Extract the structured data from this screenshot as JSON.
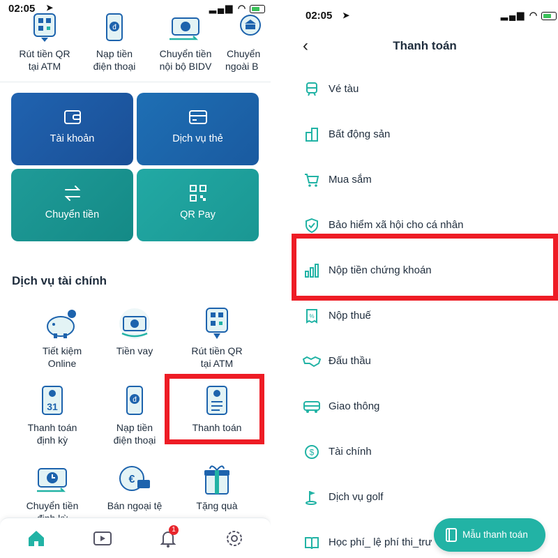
{
  "left": {
    "status": {
      "time": "02:05"
    },
    "quick_actions": [
      {
        "label_1": "Rút tiền QR",
        "label_2": "tại ATM",
        "icon": "qr-atm-icon"
      },
      {
        "label_1": "Nạp tiền",
        "label_2": "điện thoại",
        "icon": "phone-topup-icon"
      },
      {
        "label_1": "Chuyển tiền",
        "label_2": "nội bộ BIDV",
        "icon": "transfer-internal-icon"
      },
      {
        "label_1": "Chuyển",
        "label_2": "ngoài B",
        "icon": "bank-transfer-icon"
      }
    ],
    "tiles": [
      {
        "label": "Tài khoản",
        "icon": "wallet-icon"
      },
      {
        "label": "Dịch vụ thẻ",
        "icon": "card-icon"
      },
      {
        "label": "Chuyển tiền",
        "icon": "transfer-arrows-icon"
      },
      {
        "label": "QR Pay",
        "icon": "qr-icon"
      }
    ],
    "section_title": "Dịch vụ tài chính",
    "services": [
      {
        "label_1": "Tiết kiệm",
        "label_2": "Online"
      },
      {
        "label_1": "Tiền vay",
        "label_2": ""
      },
      {
        "label_1": "Rút tiền QR",
        "label_2": "tại ATM"
      },
      {
        "label_1": "Thanh toán",
        "label_2": "định kỳ",
        "badge": "31"
      },
      {
        "label_1": "Nạp tiền",
        "label_2": "điện thoại"
      },
      {
        "label_1": "Thanh toán",
        "label_2": ""
      },
      {
        "label_1": "Chuyển tiền",
        "label_2": "định kỳ"
      },
      {
        "label_1": "Bán ngoại tệ",
        "label_2": ""
      },
      {
        "label_1": "Tặng quà",
        "label_2": ""
      }
    ],
    "bottom_nav": {
      "notification_count": "1"
    }
  },
  "right": {
    "status": {
      "time": "02:05"
    },
    "header": {
      "back": "‹",
      "title": "Thanh toán"
    },
    "menu": [
      {
        "label": "Vé tàu",
        "icon": "train-icon"
      },
      {
        "label": "Bất động sản",
        "icon": "building-icon"
      },
      {
        "label": "Mua sắm",
        "icon": "cart-icon"
      },
      {
        "label": "Bảo hiểm xã hội cho cá nhân",
        "icon": "shield-icon"
      },
      {
        "label": "Nộp tiền chứng khoán",
        "icon": "bar-chart-icon"
      },
      {
        "label": "Nộp thuế",
        "icon": "receipt-icon"
      },
      {
        "label": "Đấu thầu",
        "icon": "handshake-icon"
      },
      {
        "label": "Giao thông",
        "icon": "bus-icon"
      },
      {
        "label": "Tài chính",
        "icon": "dollar-icon"
      },
      {
        "label": "Dịch vụ golf",
        "icon": "golf-flag-icon"
      },
      {
        "label": "Học phí_ lệ phí thi_trư",
        "icon": "book-icon"
      }
    ],
    "fab_label": "Mẫu thanh toán"
  },
  "colors": {
    "teal": "#22b3a5",
    "blue": "#1d63ad",
    "highlight": "#ee1c25"
  }
}
